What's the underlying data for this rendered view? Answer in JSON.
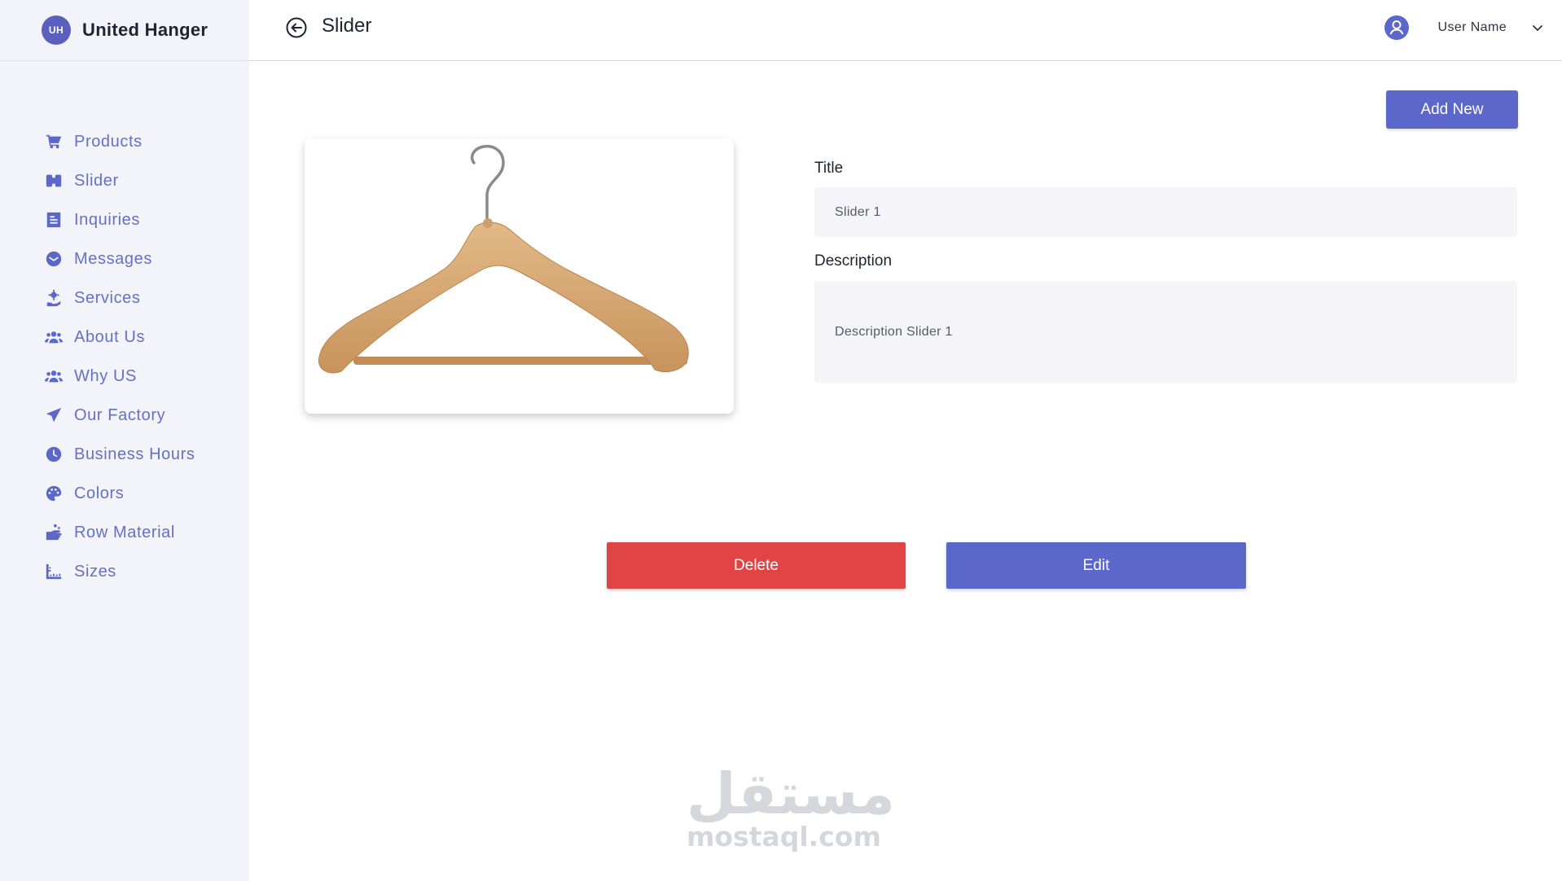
{
  "brand": {
    "logo_text": "UH",
    "name": "United Hanger"
  },
  "header": {
    "title": "Slider",
    "user_name": "User Name"
  },
  "sidebar": {
    "items": [
      {
        "label": "Products",
        "icon": "cart-icon"
      },
      {
        "label": "Slider",
        "icon": "slider-icon"
      },
      {
        "label": "Inquiries",
        "icon": "document-icon"
      },
      {
        "label": "Messages",
        "icon": "message-icon"
      },
      {
        "label": "Services",
        "icon": "gear-hand-icon"
      },
      {
        "label": "About Us",
        "icon": "users-icon"
      },
      {
        "label": "Why US",
        "icon": "users-icon"
      },
      {
        "label": "Our Factory",
        "icon": "paper-plane-icon"
      },
      {
        "label": "Business Hours",
        "icon": "clock-icon"
      },
      {
        "label": "Colors",
        "icon": "palette-icon"
      },
      {
        "label": "Row Material",
        "icon": "hand-wash-icon"
      },
      {
        "label": "Sizes",
        "icon": "ruler-icon"
      }
    ]
  },
  "main": {
    "add_new_label": "Add New",
    "title_label": "Title",
    "title_value": "Slider 1",
    "description_label": "Description",
    "description_value": "Description Slider 1",
    "delete_label": "Delete",
    "edit_label": "Edit"
  },
  "watermark": {
    "arabic": "مستقل",
    "latin": "mostaql.com"
  },
  "colors": {
    "accent": "#5b67c9",
    "danger": "#e04444",
    "sidebar_bg": "#f3f4fa",
    "input_bg": "#f5f5f9"
  }
}
